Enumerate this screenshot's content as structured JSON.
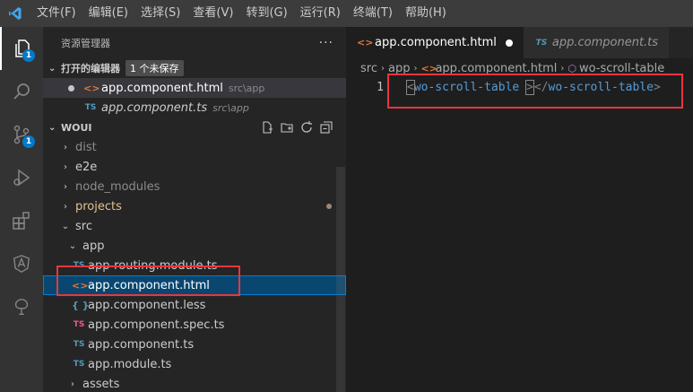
{
  "menubar": {
    "items": [
      "文件(F)",
      "编辑(E)",
      "选择(S)",
      "查看(V)",
      "转到(G)",
      "运行(R)",
      "终端(T)",
      "帮助(H)"
    ]
  },
  "activitybar": {
    "explorer_badge": "1",
    "scm_badge": "1"
  },
  "sidebar": {
    "title": "资源管理器",
    "more": "···",
    "open_editors": {
      "label": "打开的编辑器",
      "badge": "1 个未保存",
      "items": [
        {
          "name": "app.component.html",
          "path": "src\\app"
        },
        {
          "name": "app.component.ts",
          "path": "src\\app"
        }
      ]
    },
    "workspace": {
      "label": "WOUI",
      "tree": [
        {
          "name": "dist"
        },
        {
          "name": "e2e"
        },
        {
          "name": "node_modules"
        },
        {
          "name": "projects"
        },
        {
          "name": "src"
        },
        {
          "name": "app"
        },
        {
          "name": "app-routing.module.ts"
        },
        {
          "name": "app.component.html"
        },
        {
          "name": "app.component.less"
        },
        {
          "name": "app.component.spec.ts"
        },
        {
          "name": "app.component.ts"
        },
        {
          "name": "app.module.ts"
        },
        {
          "name": "assets"
        }
      ]
    }
  },
  "editor": {
    "tabs": [
      {
        "label": "app.component.html",
        "icon": "html-file-icon",
        "dirty": true
      },
      {
        "label": "app.component.ts",
        "icon": "ts-file-icon",
        "dirty": false
      }
    ],
    "breadcrumb": [
      "src",
      "app",
      "app.component.html",
      "wo-scroll-table"
    ],
    "line_number": "1",
    "code": {
      "open_bracket": "<",
      "tag": "wo-scroll-table",
      "close_open_bracket": ">",
      "end_open": "</",
      "end_tag": "wo-scroll-table",
      "end_close": ">"
    }
  },
  "colors": {
    "accent": "#007acc",
    "annotation": "#e8373c",
    "tag": "#569cd6",
    "html_icon": "#e37933",
    "ts_icon": "#519aba"
  }
}
